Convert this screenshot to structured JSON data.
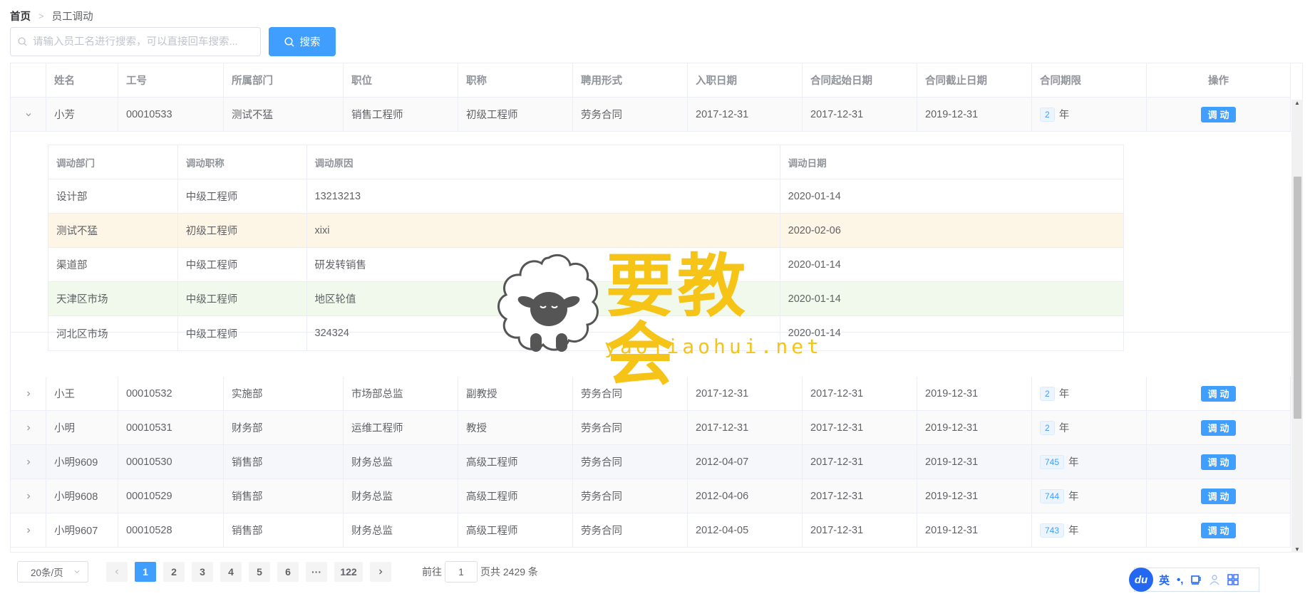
{
  "breadcrumb": {
    "home": "首页",
    "current": "员工调动"
  },
  "search": {
    "placeholder": "请输入员工名进行搜索，可以直接回车搜索...",
    "value": "",
    "button_label": "搜索"
  },
  "table": {
    "columns": [
      "",
      "姓名",
      "工号",
      "所属部门",
      "职位",
      "职称",
      "聘用形式",
      "入职日期",
      "合同起始日期",
      "合同截止日期",
      "合同期限",
      "操作"
    ],
    "term_unit": "年",
    "action_label": "调动",
    "rows": [
      {
        "name": "小芳",
        "id": "00010533",
        "dept": "测试不猛",
        "position": "销售工程师",
        "title": "初级工程师",
        "employ": "劳务合同",
        "entry": "2017-12-31",
        "start": "2017-12-31",
        "end": "2019-12-31",
        "term": "2",
        "expanded": true
      },
      {
        "name": "小王",
        "id": "00010532",
        "dept": "实施部",
        "position": "市场部总监",
        "title": "副教授",
        "employ": "劳务合同",
        "entry": "2017-12-31",
        "start": "2017-12-31",
        "end": "2019-12-31",
        "term": "2"
      },
      {
        "name": "小明",
        "id": "00010531",
        "dept": "财务部",
        "position": "运维工程师",
        "title": "教授",
        "employ": "劳务合同",
        "entry": "2017-12-31",
        "start": "2017-12-31",
        "end": "2019-12-31",
        "term": "2"
      },
      {
        "name": "小明9609",
        "id": "00010530",
        "dept": "销售部",
        "position": "财务总监",
        "title": "高级工程师",
        "employ": "劳务合同",
        "entry": "2012-04-07",
        "start": "2017-12-31",
        "end": "2019-12-31",
        "term": "745"
      },
      {
        "name": "小明9608",
        "id": "00010529",
        "dept": "销售部",
        "position": "财务总监",
        "title": "高级工程师",
        "employ": "劳务合同",
        "entry": "2012-04-06",
        "start": "2017-12-31",
        "end": "2019-12-31",
        "term": "744"
      },
      {
        "name": "小明9607",
        "id": "00010528",
        "dept": "销售部",
        "position": "财务总监",
        "title": "高级工程师",
        "employ": "劳务合同",
        "entry": "2012-04-05",
        "start": "2017-12-31",
        "end": "2019-12-31",
        "term": "743"
      }
    ]
  },
  "transfer_history": {
    "columns": [
      "调动部门",
      "调动职称",
      "调动原因",
      "调动日期"
    ],
    "rows": [
      {
        "dept": "设计部",
        "title": "中级工程师",
        "reason": "13213213",
        "date": "2020-01-14"
      },
      {
        "dept": "测试不猛",
        "title": "初级工程师",
        "reason": "xixi",
        "date": "2020-02-06"
      },
      {
        "dept": "渠道部",
        "title": "中级工程师",
        "reason": "研发转销售",
        "date": "2020-01-14"
      },
      {
        "dept": "天津区市场",
        "title": "中级工程师",
        "reason": "地区轮值",
        "date": "2020-01-14"
      },
      {
        "dept": "河北区市场",
        "title": "中级工程师",
        "reason": "324324",
        "date": "2020-01-14"
      }
    ]
  },
  "pagination": {
    "page_size": "20条/页",
    "pages": [
      "1",
      "2",
      "3",
      "4",
      "5",
      "6",
      "···",
      "122"
    ],
    "current": "1",
    "goto_prefix": "前往",
    "goto_value": "1",
    "goto_suffix": "页",
    "total": "共 2429 条"
  },
  "watermark": {
    "title": "要教会",
    "url": "yaojiaohui.net"
  },
  "ime": {
    "logo": "du",
    "lang": "英",
    "punct": "•,",
    "colors": {
      "brand": "#2468f2"
    }
  },
  "colors": {
    "primary": "#409eff",
    "warning_row": "#fdf5e6",
    "success_row": "#f0f9eb",
    "watermark": "#f6c417"
  }
}
